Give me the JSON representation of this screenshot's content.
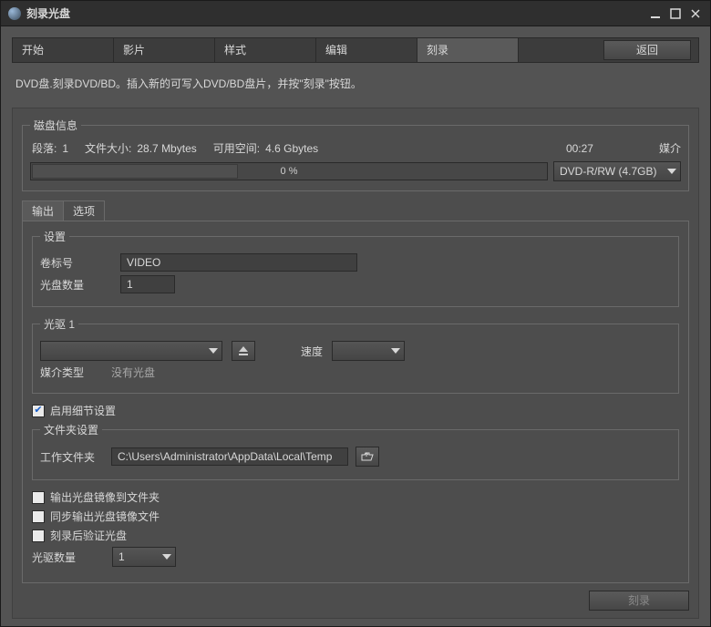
{
  "window": {
    "title": "刻录光盘"
  },
  "tabs": {
    "items": [
      "开始",
      "影片",
      "样式",
      "编辑",
      "刻录"
    ],
    "active_index": 4,
    "return_label": "返回"
  },
  "instruction": "DVD盘.刻录DVD/BD。插入新的可写入DVD/BD盘片，并按\"刻录\"按钮。",
  "disc_info": {
    "legend": "磁盘信息",
    "segments_label": "段落:",
    "segments_value": "1",
    "filesize_label": "文件大小:",
    "filesize_value": "28.7 Mbytes",
    "freespace_label": "可用空间:",
    "freespace_value": "4.6 Gbytes",
    "duration": "00:27",
    "media_label": "媒介",
    "media_selected": "DVD-R/RW (4.7GB)",
    "progress_text": "0 %"
  },
  "subtabs": {
    "items": [
      "输出",
      "选项"
    ],
    "active_index": 0
  },
  "settings": {
    "legend": "设置",
    "volume_label": "卷标号",
    "volume_value": "VIDEO",
    "copies_label": "光盘数量",
    "copies_value": "1"
  },
  "drive": {
    "legend": "光驱 1",
    "drive_selected": "",
    "speed_label": "速度",
    "speed_selected": "",
    "media_type_label": "媒介类型",
    "media_type_value": "没有光盘"
  },
  "advanced": {
    "enable_label": "启用细节设置",
    "enable_checked": true,
    "folder_legend": "文件夹设置",
    "workdir_label": "工作文件夹",
    "workdir_value": "C:\\Users\\Administrator\\AppData\\Local\\Temp",
    "opts": [
      {
        "label": "输出光盘镜像到文件夹",
        "checked": false
      },
      {
        "label": "同步输出光盘镜像文件",
        "checked": false
      },
      {
        "label": "刻录后验证光盘",
        "checked": false
      }
    ],
    "drive_count_label": "光驱数量",
    "drive_count_value": "1"
  },
  "footer": {
    "burn_label": "刻录"
  }
}
